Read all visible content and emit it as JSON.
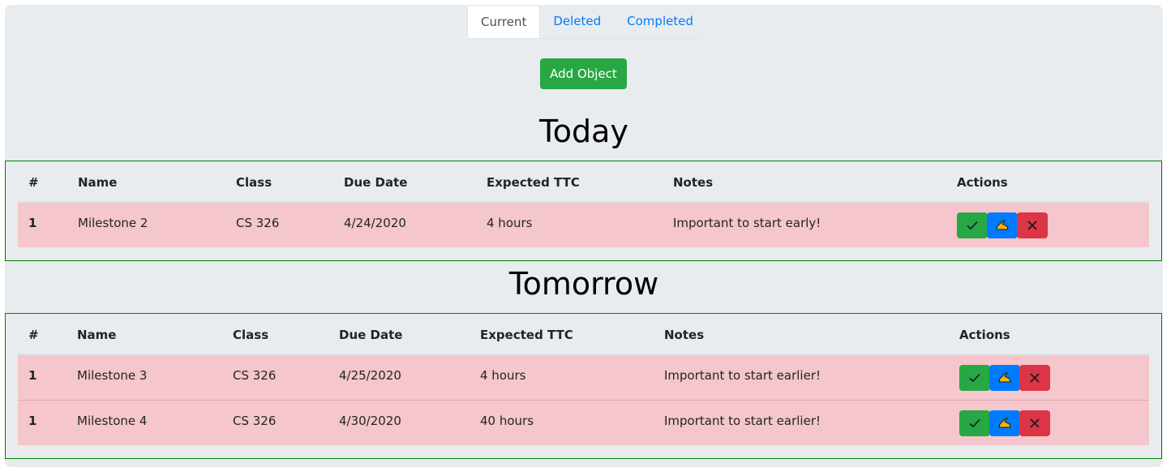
{
  "tabs": [
    {
      "label": "Current",
      "active": true
    },
    {
      "label": "Deleted",
      "active": false
    },
    {
      "label": "Completed",
      "active": false
    }
  ],
  "add_button_label": "Add Object",
  "columns": [
    "#",
    "Name",
    "Class",
    "Due Date",
    "Expected TTC",
    "Notes",
    "Actions"
  ],
  "sections": [
    {
      "title": "Today",
      "rows": [
        {
          "num": "1",
          "name": "Milestone 2",
          "class": "CS 326",
          "due": "4/24/2020",
          "ttc": "4 hours",
          "notes": "Important to start early!"
        }
      ]
    },
    {
      "title": "Tomorrow",
      "rows": [
        {
          "num": "1",
          "name": "Milestone 3",
          "class": "CS 326",
          "due": "4/25/2020",
          "ttc": "4 hours",
          "notes": "Important to start earlier!"
        },
        {
          "num": "1",
          "name": "Milestone 4",
          "class": "CS 326",
          "due": "4/30/2020",
          "ttc": "40 hours",
          "notes": "Important to start earlier!"
        }
      ]
    }
  ],
  "colors": {
    "panel_bg": "#e9ecef",
    "row_bg": "#f5c6cb",
    "table_border": "#008000",
    "success": "#28a745",
    "primary": "#007bff",
    "danger": "#dc3545"
  },
  "action_icons": [
    "check-icon",
    "writing-hand-icon",
    "close-icon"
  ]
}
